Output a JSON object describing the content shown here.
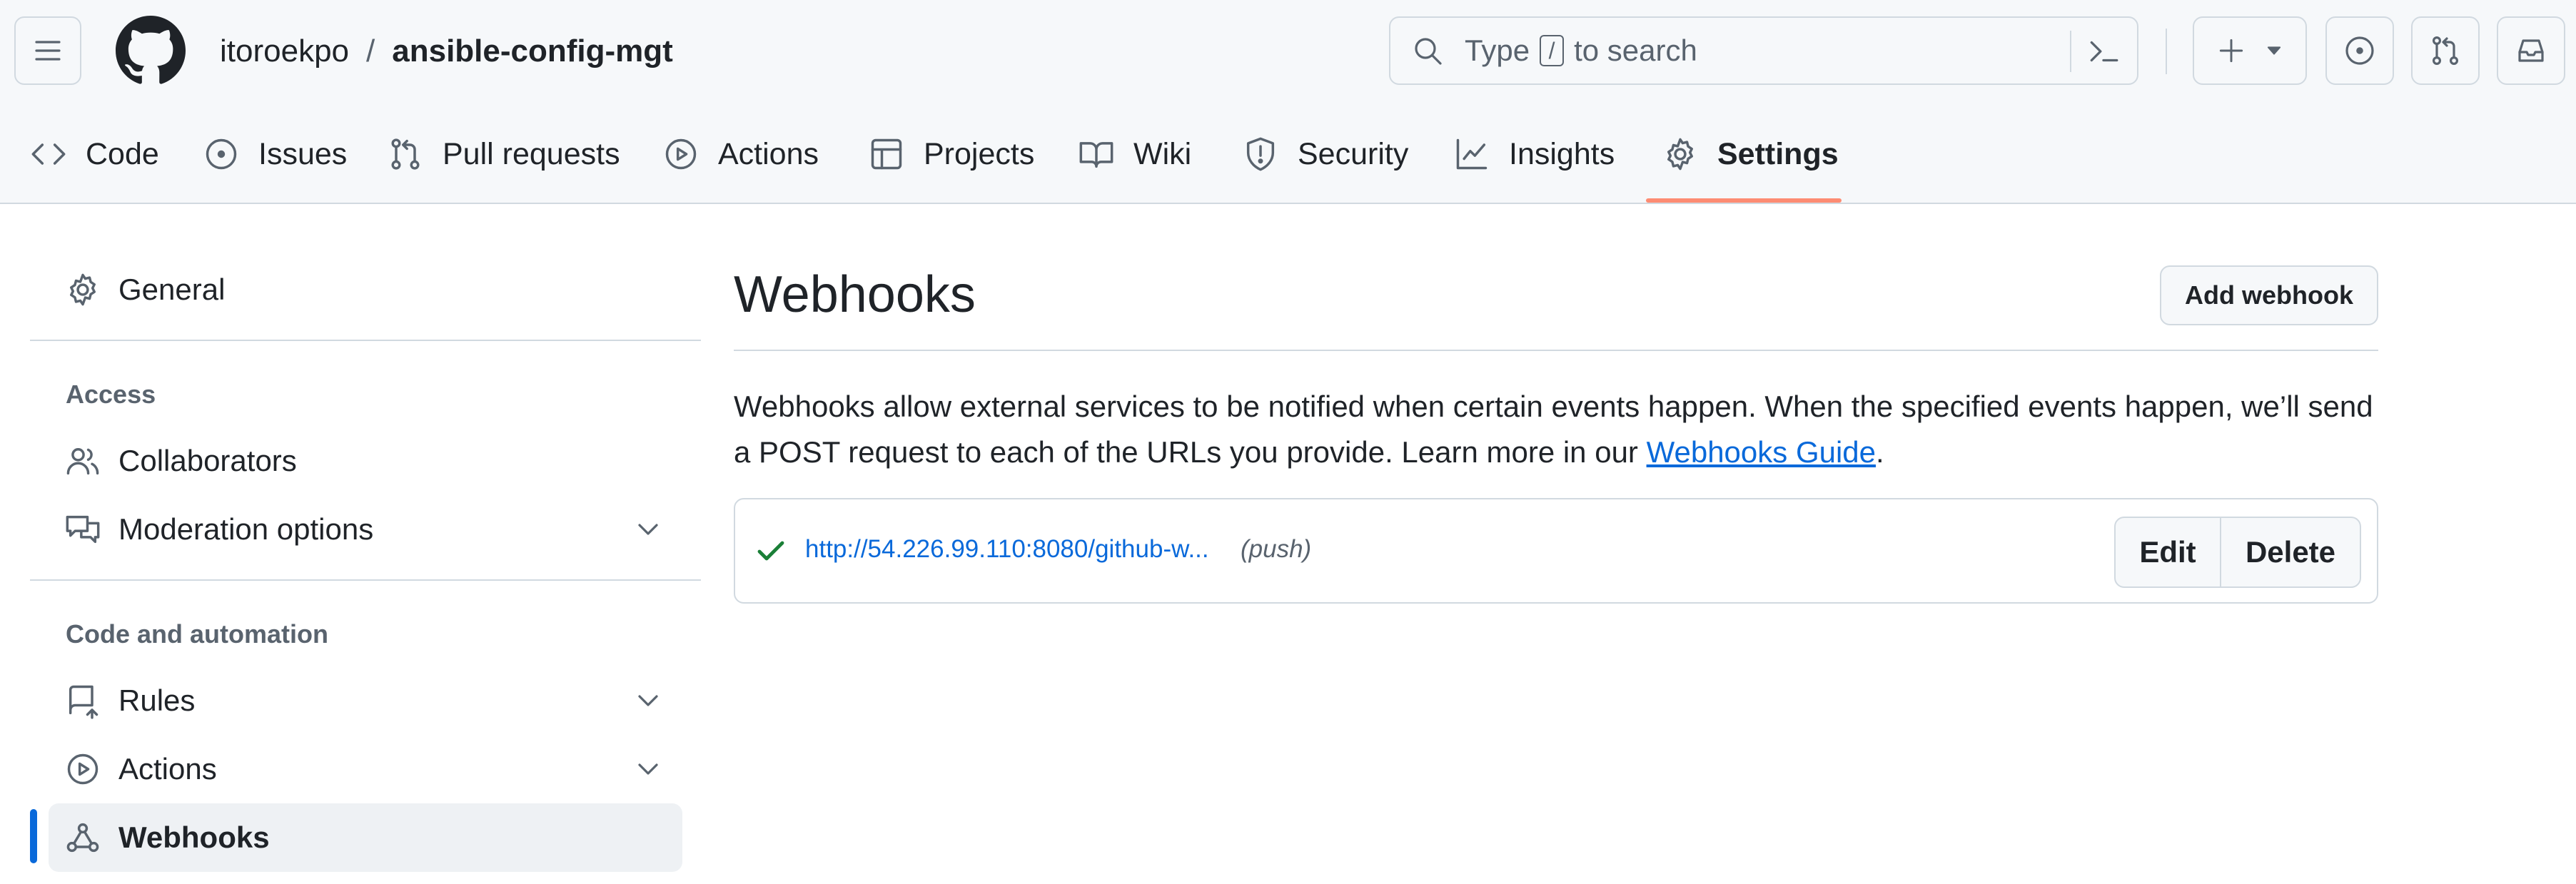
{
  "header": {
    "owner": "itoroekpo",
    "separator": "/",
    "repo": "ansible-config-mgt",
    "search": {
      "prefix": "Type",
      "key": "/",
      "suffix": "to search"
    },
    "plus_label": "+"
  },
  "nav_tabs": [
    {
      "label": "Code",
      "icon": "code-icon"
    },
    {
      "label": "Issues",
      "icon": "issue-icon"
    },
    {
      "label": "Pull requests",
      "icon": "pull-request-icon"
    },
    {
      "label": "Actions",
      "icon": "play-icon"
    },
    {
      "label": "Projects",
      "icon": "table-icon"
    },
    {
      "label": "Wiki",
      "icon": "book-icon"
    },
    {
      "label": "Security",
      "icon": "shield-icon"
    },
    {
      "label": "Insights",
      "icon": "graph-icon"
    },
    {
      "label": "Settings",
      "icon": "gear-icon",
      "active": true
    }
  ],
  "sidebar": {
    "general": "General",
    "access_heading": "Access",
    "collaborators": "Collaborators",
    "moderation": "Moderation options",
    "code_heading": "Code and automation",
    "rules": "Rules",
    "actions": "Actions",
    "webhooks": "Webhooks"
  },
  "main": {
    "title": "Webhooks",
    "add_button": "Add webhook",
    "description": "Webhooks allow external services to be notified when certain events happen. When the specified events happen, we’ll send a POST request to each of the URLs you provide. Learn more in our",
    "guide_link": "Webhooks Guide",
    "period": ".",
    "webhook": {
      "url": "http://54.226.99.110:8080/github-w...",
      "events": "(push)",
      "status": "success"
    },
    "edit_button": "Edit",
    "delete_button": "Delete"
  },
  "colors": {
    "accent_blue": "#0969da",
    "tab_underline": "#fd8c73",
    "success_green": "#1a7f37"
  }
}
